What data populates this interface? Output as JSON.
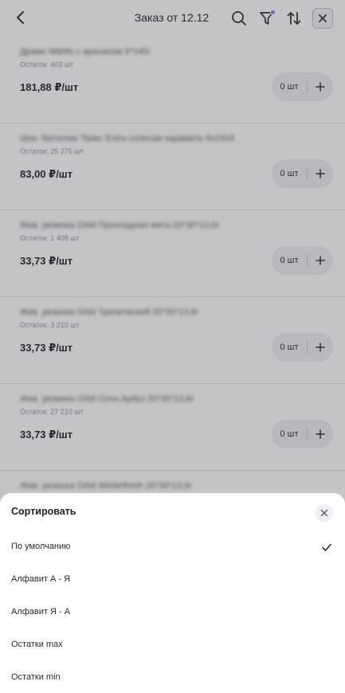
{
  "header": {
    "title": "Заказ от 12.12"
  },
  "products": [
    {
      "name": "Драже M&Ms с арахисом 9*145г",
      "stock": "Остаток: 403 шт",
      "price": "181,88 ₽/шт",
      "qty": "0 шт"
    },
    {
      "name": "Шок. батончик Твикс Extra соленая карамель 6х24х8",
      "stock": "Остаток: 25 275 шт",
      "price": "83,00 ₽/шт",
      "qty": "0 шт"
    },
    {
      "name": "Жев. резинка Orbit Прохладная мята 20*30*13,6г",
      "stock": "Остаток: 1 408 шт",
      "price": "33,73 ₽/шт",
      "qty": "0 шт"
    },
    {
      "name": "Жев. резинка Orbit Тропический 20*30*13,6г",
      "stock": "Остаток: 3 210 шт",
      "price": "33,73 ₽/шт",
      "qty": "0 шт"
    },
    {
      "name": "Жев. резинка Orbit Сочн.Арбуз 20*30*13,6г",
      "stock": "Остаток: 27 210 шт",
      "price": "33,73 ₽/шт",
      "qty": "0 шт"
    },
    {
      "name": "Жев. резинка Orbit Winterfresh 20*30*13,6г",
      "stock": "",
      "price": "",
      "qty": ""
    }
  ],
  "sort_sheet": {
    "title": "Сортировать",
    "options": [
      {
        "label": "По умолчанию",
        "selected": true
      },
      {
        "label": "Алфавит А - Я",
        "selected": false
      },
      {
        "label": "Алфавит Я - А",
        "selected": false
      },
      {
        "label": "Остатки max",
        "selected": false
      },
      {
        "label": "Остатки min",
        "selected": false
      }
    ]
  },
  "colors": {
    "accent": "#8b7ee8",
    "overlay": "rgba(60,60,70,0.30)",
    "text": "#1f1f24"
  },
  "icons": [
    "back-arrow-icon",
    "search-icon",
    "filter-icon",
    "sort-icon",
    "close-icon",
    "plus-icon",
    "checkmark-icon"
  ]
}
